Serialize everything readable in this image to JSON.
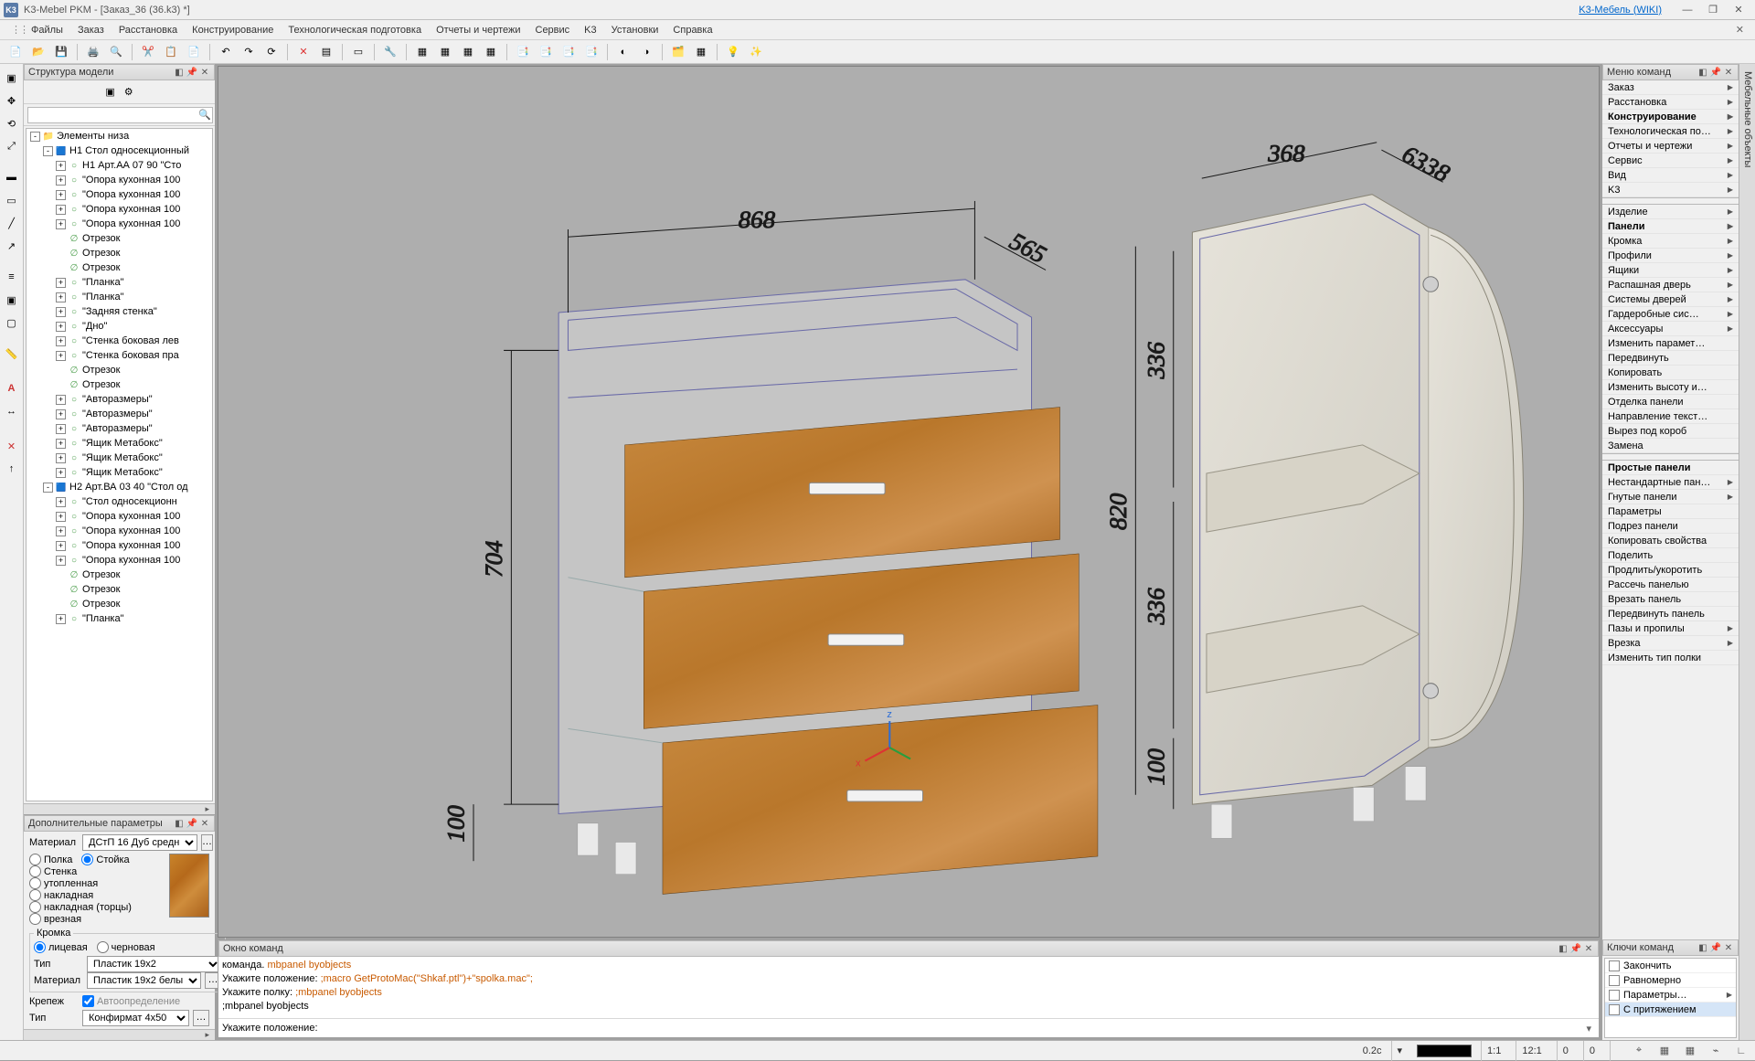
{
  "title": "K3-Mebel PKM - [Заказ_36 (36.k3) *]",
  "wiki_link": "K3-Мебель (WIKI)",
  "menubar": [
    "Файлы",
    "Заказ",
    "Расстановка",
    "Конструирование",
    "Технологическая подготовка",
    "Отчеты и чертежи",
    "Сервис",
    "K3",
    "Установки",
    "Справка"
  ],
  "left_panel_title": "Структура модели",
  "tree_root": "Элементы низа",
  "tree": [
    {
      "d": 0,
      "exp": "-",
      "ic": "📁",
      "t": "Элементы низа"
    },
    {
      "d": 1,
      "exp": "-",
      "ic": "🟦",
      "t": "Н1 Стол односекционный"
    },
    {
      "d": 2,
      "exp": "+",
      "ic": "○",
      "t": "Н1 Арт.АА 07 90 \"Сто"
    },
    {
      "d": 2,
      "exp": "+",
      "ic": "○",
      "t": "\"Опора кухонная 100"
    },
    {
      "d": 2,
      "exp": "+",
      "ic": "○",
      "t": "\"Опора кухонная 100"
    },
    {
      "d": 2,
      "exp": "+",
      "ic": "○",
      "t": "\"Опора кухонная 100"
    },
    {
      "d": 2,
      "exp": "+",
      "ic": "○",
      "t": "\"Опора кухонная 100"
    },
    {
      "d": 2,
      "exp": "",
      "ic": "∅",
      "t": "Отрезок"
    },
    {
      "d": 2,
      "exp": "",
      "ic": "∅",
      "t": "Отрезок"
    },
    {
      "d": 2,
      "exp": "",
      "ic": "∅",
      "t": "Отрезок"
    },
    {
      "d": 2,
      "exp": "+",
      "ic": "○",
      "t": "\"Планка\""
    },
    {
      "d": 2,
      "exp": "+",
      "ic": "○",
      "t": "\"Планка\""
    },
    {
      "d": 2,
      "exp": "+",
      "ic": "○",
      "t": "\"Задняя стенка\""
    },
    {
      "d": 2,
      "exp": "+",
      "ic": "○",
      "t": "\"Дно\""
    },
    {
      "d": 2,
      "exp": "+",
      "ic": "○",
      "t": "\"Стенка боковая лев"
    },
    {
      "d": 2,
      "exp": "+",
      "ic": "○",
      "t": "\"Стенка боковая пра"
    },
    {
      "d": 2,
      "exp": "",
      "ic": "∅",
      "t": "Отрезок"
    },
    {
      "d": 2,
      "exp": "",
      "ic": "∅",
      "t": "Отрезок"
    },
    {
      "d": 2,
      "exp": "+",
      "ic": "○",
      "t": "\"Авторазмеры\""
    },
    {
      "d": 2,
      "exp": "+",
      "ic": "○",
      "t": "\"Авторазмеры\""
    },
    {
      "d": 2,
      "exp": "+",
      "ic": "○",
      "t": "\"Авторазмеры\""
    },
    {
      "d": 2,
      "exp": "+",
      "ic": "○",
      "t": "\"Ящик Метабокс\""
    },
    {
      "d": 2,
      "exp": "+",
      "ic": "○",
      "t": "\"Ящик Метабокс\""
    },
    {
      "d": 2,
      "exp": "+",
      "ic": "○",
      "t": "\"Ящик Метабокс\""
    },
    {
      "d": 1,
      "exp": "-",
      "ic": "🟦",
      "t": "Н2 Арт.ВА 03 40 \"Стол од"
    },
    {
      "d": 2,
      "exp": "+",
      "ic": "○",
      "t": "\"Стол односекционн"
    },
    {
      "d": 2,
      "exp": "+",
      "ic": "○",
      "t": "\"Опора кухонная 100"
    },
    {
      "d": 2,
      "exp": "+",
      "ic": "○",
      "t": "\"Опора кухонная 100"
    },
    {
      "d": 2,
      "exp": "+",
      "ic": "○",
      "t": "\"Опора кухонная 100"
    },
    {
      "d": 2,
      "exp": "+",
      "ic": "○",
      "t": "\"Опора кухонная 100"
    },
    {
      "d": 2,
      "exp": "",
      "ic": "∅",
      "t": "Отрезок"
    },
    {
      "d": 2,
      "exp": "",
      "ic": "∅",
      "t": "Отрезок"
    },
    {
      "d": 2,
      "exp": "",
      "ic": "∅",
      "t": "Отрезок"
    },
    {
      "d": 2,
      "exp": "+",
      "ic": "○",
      "t": "\"Планка\""
    }
  ],
  "addparams_title": "Дополнительные параметры",
  "ap": {
    "material_label": "Материал",
    "material_value": "ДСтП 16 Дуб средн",
    "r_polka": "Полка",
    "r_stoika": "Стойка",
    "r_stenka": "Стенка",
    "r_utopl": "утопленная",
    "r_nakl": "накладная",
    "r_nakltorc": "накладная (торцы)",
    "r_vrez": "врезная",
    "kromka": "Кромка",
    "lic": "лицевая",
    "tcher": "черновая",
    "tip_label": "Тип",
    "tip_value": "Пластик 19x2",
    "material2_label": "Материал",
    "material2_value": "Пластик 19x2 белы",
    "krepezh": "Крепеж",
    "auto": "Автоопределение",
    "tip2_label": "Тип",
    "tip2_value": "Конфирмат 4x50"
  },
  "cmd_title": "Окно команд",
  "cmd_lines": [
    {
      "a": "команда. ",
      "b": "mbpanel byobjects"
    },
    {
      "a": "Укажите положение: ",
      "b": ";macro GetProtoMac(\"Shkaf.ptl\")+\"spolka.mac\";"
    },
    {
      "a": "Укажите полку: ",
      "b": ";mbpanel byobjects"
    },
    {
      "a": ";mbpanel byobjects",
      "b": ""
    }
  ],
  "cmd_prompt": "Укажите положение: ",
  "right_menu_title": "Меню команд",
  "right_side_tab": "Мебельные объекты",
  "right_menu_groups": [
    [
      {
        "t": "Заказ",
        "a": true
      },
      {
        "t": "Расстановка",
        "a": true
      },
      {
        "t": "Конструирование",
        "a": true,
        "bold": true
      },
      {
        "t": "Технологическая по…",
        "a": true
      },
      {
        "t": "Отчеты и чертежи",
        "a": true
      },
      {
        "t": "Сервис",
        "a": true
      },
      {
        "t": "Вид",
        "a": true
      },
      {
        "t": "K3",
        "a": true
      }
    ],
    [
      {
        "t": "Изделие",
        "a": true
      },
      {
        "t": "Панели",
        "a": true,
        "bold": true
      },
      {
        "t": "Кромка",
        "a": true
      },
      {
        "t": "Профили",
        "a": true
      },
      {
        "t": "Ящики",
        "a": true
      },
      {
        "t": "Распашная дверь",
        "a": true
      },
      {
        "t": "Системы дверей",
        "a": true
      },
      {
        "t": "Гардеробные сис…",
        "a": true
      },
      {
        "t": "Аксессуары",
        "a": true
      },
      {
        "t": "Изменить парамет…",
        "a": false
      },
      {
        "t": "Передвинуть",
        "a": false
      },
      {
        "t": "Копировать",
        "a": false
      },
      {
        "t": "Изменить высоту и…",
        "a": false
      },
      {
        "t": "Отделка панели",
        "a": false
      },
      {
        "t": "Направление текст…",
        "a": false
      },
      {
        "t": "Вырез под короб",
        "a": false
      },
      {
        "t": "Замена",
        "a": false
      }
    ],
    [
      {
        "t": "Простые панели",
        "a": false,
        "bold": true
      },
      {
        "t": "Нестандартные пан…",
        "a": true
      },
      {
        "t": "Гнутые панели",
        "a": true
      },
      {
        "t": "Параметры",
        "a": false
      },
      {
        "t": "Подрез панели",
        "a": false
      },
      {
        "t": "Копировать свойства",
        "a": false
      },
      {
        "t": "Поделить",
        "a": false
      },
      {
        "t": "Продлить/укоротить",
        "a": false
      },
      {
        "t": "Рассечь панелью",
        "a": false
      },
      {
        "t": "Врезать панель",
        "a": false
      },
      {
        "t": "Передвинуть панель",
        "a": false
      },
      {
        "t": "Пазы и пропилы",
        "a": true
      },
      {
        "t": "Врезка",
        "a": true
      },
      {
        "t": "Изменить тип полки",
        "a": false
      }
    ]
  ],
  "keys_title": "Ключи команд",
  "keys": [
    {
      "t": "Закончить",
      "a": false
    },
    {
      "t": "Равномерно",
      "a": false
    },
    {
      "t": "Параметры…",
      "a": true
    },
    {
      "t": "С притяжением",
      "a": false,
      "sel": true
    }
  ],
  "status": {
    "time": "0.2c",
    "scale1": "1:1",
    "scale2": "12:1",
    "zero": "0",
    "zero2": "0"
  },
  "dims": {
    "w868": "868",
    "w565": "565",
    "h704": "704",
    "h100": "100",
    "w368": "368",
    "w6338": "6338",
    "h820": "820",
    "h336a": "336",
    "h336b": "336",
    "h100b": "100"
  }
}
